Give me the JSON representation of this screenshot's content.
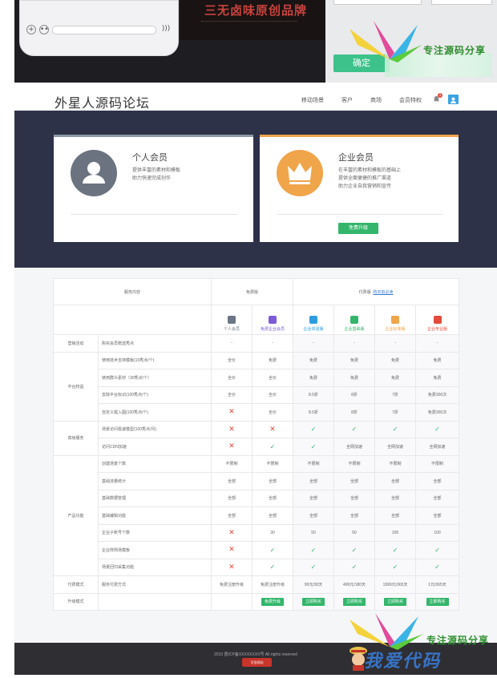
{
  "top_strip": {
    "banner_title": "三无卤味原创品牌",
    "confirm_label": "确定",
    "watermark_text": "专注源码分享"
  },
  "header": {
    "logo": "外星人源码论坛",
    "nav": [
      "移动场景",
      "客户",
      "商场",
      "会员特权"
    ],
    "notification_count": "1"
  },
  "hero": {
    "personal": {
      "title": "个人会员",
      "desc": [
        "提供丰富的素材和模板",
        "助力快速完成创作"
      ]
    },
    "enterprise": {
      "title": "企业会员",
      "desc": [
        "在丰富的素材和模板的基础上",
        "提供全面便捷的推广渠道",
        "助力企业自我营销和宣传"
      ],
      "button": "免费升级"
    }
  },
  "table": {
    "head": {
      "col1": "服务内容",
      "free": "免费版",
      "paid": "付费版",
      "paid_link": "购买前必读"
    },
    "plans": [
      {
        "name": "个人会员",
        "color": "#6b7785"
      },
      {
        "name": "免费企业会员",
        "color": "#7b5bd6"
      },
      {
        "name": "企业体验版",
        "color": "#2e9de0"
      },
      {
        "name": "企业基础版",
        "color": "#33b66b"
      },
      {
        "name": "企业标准版",
        "color": "#f0a54a"
      },
      {
        "name": "企业专业版",
        "color": "#e24a3b"
      }
    ],
    "rows": [
      {
        "group": "营销活动",
        "item": "购买会员赠送秀点",
        "cells": [
          "-",
          "-",
          "-",
          "-",
          "-",
          "-"
        ]
      },
      {
        "group": "平台权益",
        "item": "使用技术支持模板(10秀点/个)",
        "cells": [
          "全价",
          "免费",
          "免费",
          "免费",
          "免费",
          "免费"
        ]
      },
      {
        "group": "",
        "item": "使用群众素材（30秀点/个）",
        "cells": [
          "全价",
          "全价",
          "免费",
          "免费",
          "免费",
          "免费"
        ]
      },
      {
        "group": "",
        "item": "去除平台标识(100秀点/个)",
        "cells": [
          "全价",
          "全价",
          "8.5折",
          "8折",
          "7折",
          "免费300次"
        ]
      },
      {
        "group": "",
        "item": "自定义载入图(100秀点/个)",
        "cells": [
          "x",
          "全价",
          "8.5折",
          "8折",
          "7折",
          "免费300次"
        ]
      },
      {
        "group": "高级服务",
        "item": "场景访问极速模型(100秀点/月)",
        "cells": [
          "x",
          "x",
          "ok",
          "ok",
          "ok",
          "ok"
        ]
      },
      {
        "group": "",
        "item": "访问CDN加速",
        "cells": [
          "x",
          "ok",
          "ok",
          "全网加速",
          "全网加速",
          "全网加速"
        ]
      },
      {
        "group": "产品功能",
        "item": "创建场景个数",
        "cells": [
          "不限制",
          "不限制",
          "不限制",
          "不限制",
          "不限制",
          "不限制"
        ]
      },
      {
        "group": "",
        "item": "基础流量统计",
        "cells": [
          "全部",
          "全部",
          "全部",
          "全部",
          "全部",
          "全部"
        ]
      },
      {
        "group": "",
        "item": "基础数据管理",
        "cells": [
          "全部",
          "全部",
          "全部",
          "全部",
          "全部",
          "全部"
        ]
      },
      {
        "group": "",
        "item": "基础编辑功能",
        "cells": [
          "全部",
          "全部",
          "全部",
          "全部",
          "全部",
          "全部"
        ]
      },
      {
        "group": "",
        "item": "企业子账号个数",
        "cells": [
          "x",
          "30",
          "50",
          "50",
          "100",
          "100"
        ]
      },
      {
        "group": "",
        "item": "企业样例场模板",
        "cells": [
          "x",
          "ok",
          "ok",
          "ok",
          "ok",
          "ok"
        ]
      },
      {
        "group": "",
        "item": "场景回归采集功能",
        "cells": [
          "x",
          "ok",
          "ok",
          "ok",
          "ok",
          "ok"
        ]
      },
      {
        "group": "付费模式",
        "item": "服务付费方式",
        "cells": [
          "免费注册升级",
          "免费注册升级",
          "99元/30天",
          "499元/180天",
          "1999元/365天",
          "1元/365天"
        ]
      },
      {
        "group": "升级模式",
        "item": "",
        "cells": [
          "",
          "免费升级",
          "立即购买",
          "立即购买",
          "立即购买",
          "立即购买"
        ]
      }
    ]
  },
  "footer": {
    "copyright": "2015 晋ICP备XXXXXXXX号  All rights reserved",
    "seal": "可信网站",
    "watermark_text": "专注源码分享",
    "watermark_big": "我爱代码"
  }
}
